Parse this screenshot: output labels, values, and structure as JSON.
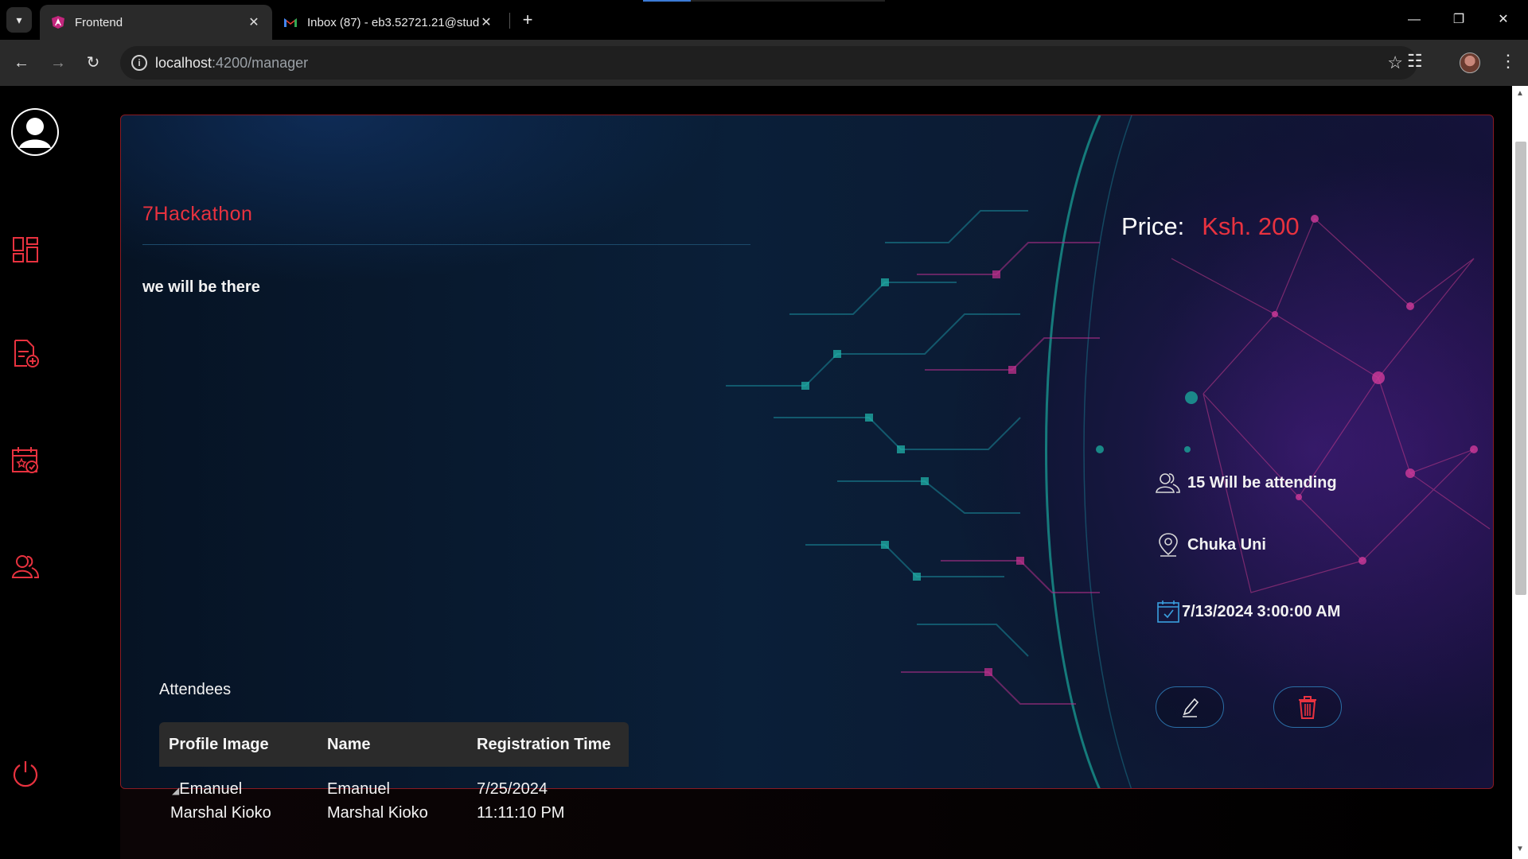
{
  "browser": {
    "tabs": [
      {
        "title": "Frontend",
        "active": true
      },
      {
        "title": "Inbox (87) - eb3.52721.21@stud",
        "active": false
      }
    ],
    "address": {
      "host": "localhost",
      "path": ":4200/manager"
    }
  },
  "sidebar": {
    "items": [
      "dashboard-icon",
      "add-event-icon",
      "events-calendar-icon",
      "users-icon",
      "logout-icon"
    ]
  },
  "event": {
    "title": "7Hackathon",
    "description": "we will be there",
    "price_label": "Price:",
    "price_value": "Ksh. 200",
    "attending": "15 Will be attending",
    "location": "Chuka Uni",
    "datetime": "7/13/2024 3:00:00 AM"
  },
  "attendees": {
    "title": "Attendees",
    "columns": [
      "Profile Image",
      "Name",
      "Registration Time"
    ],
    "rows": [
      {
        "image_alt": "Emanuel Marshal Kioko",
        "name": "Emanuel Marshal Kioko",
        "time": "7/25/2024 11:11:10 PM"
      }
    ],
    "img_line1": "Emanuel",
    "img_line2": "Marshal Kioko",
    "name_line1": "Emanuel",
    "name_line2": "Marshal Kioko",
    "time_line1": "7/25/2024",
    "time_line2": "11:11:10 PM"
  },
  "colors": {
    "accent": "#e8323f",
    "card_border": "#8a1a22",
    "button_border": "#2a6ea6"
  }
}
